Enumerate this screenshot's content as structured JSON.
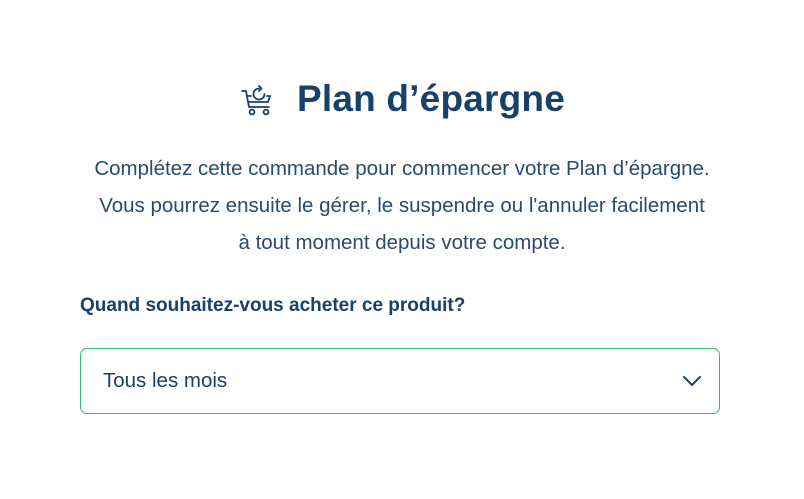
{
  "header": {
    "icon": "shopping-cart-refresh-icon",
    "title": "Plan d’épargne"
  },
  "description": "Complétez cette commande pour commencer votre Plan d’épargne. Vous pourrez ensuite le gérer, le suspendre ou l'annuler facilement à tout moment depuis votre compte.",
  "frequency": {
    "question": "Quand souhaitez-vous acheter ce produit?",
    "selected": "Tous les mois",
    "icon": "chevron-down-icon"
  },
  "colors": {
    "primary_text": "#17406a",
    "body_text": "#2a4a6e",
    "select_border": "#2eb872"
  }
}
